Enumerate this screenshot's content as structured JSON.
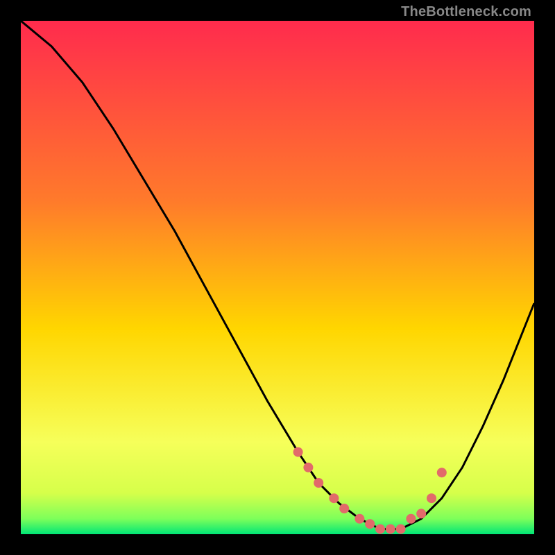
{
  "watermark": "TheBottleneck.com",
  "colors": {
    "bg": "#000000",
    "grad_top": "#ff2b4d",
    "grad_mid1": "#ff7a2b",
    "grad_mid2": "#ffd600",
    "grad_low": "#f6ff5a",
    "grad_bottom": "#00e676",
    "curve": "#000000",
    "dots": "#e26a6a"
  },
  "chart_data": {
    "type": "line",
    "title": "",
    "xlabel": "",
    "ylabel": "",
    "xlim": [
      0,
      100
    ],
    "ylim": [
      0,
      100
    ],
    "series": [
      {
        "name": "bottleneck-curve",
        "x": [
          0,
          6,
          12,
          18,
          24,
          30,
          36,
          42,
          48,
          54,
          58,
          62,
          66,
          70,
          74,
          78,
          82,
          86,
          90,
          94,
          98,
          100
        ],
        "y": [
          100,
          95,
          88,
          79,
          69,
          59,
          48,
          37,
          26,
          16,
          10,
          6,
          3,
          1,
          1,
          3,
          7,
          13,
          21,
          30,
          40,
          45
        ]
      }
    ],
    "dots": {
      "name": "markers",
      "x": [
        54,
        56,
        58,
        61,
        63,
        66,
        68,
        70,
        72,
        74,
        76,
        78,
        80,
        82
      ],
      "y": [
        16,
        13,
        10,
        7,
        5,
        3,
        2,
        1,
        1,
        1,
        3,
        4,
        7,
        12
      ]
    },
    "gradient_bands": [
      {
        "y": 98,
        "color": "#00e676"
      },
      {
        "y": 95,
        "color": "#7dff5a"
      },
      {
        "y": 90,
        "color": "#d6ff4a"
      },
      {
        "y": 82,
        "color": "#f6ff5a"
      },
      {
        "y": 60,
        "color": "#ffd600"
      },
      {
        "y": 35,
        "color": "#ff7a2b"
      },
      {
        "y": 0,
        "color": "#ff2b4d"
      }
    ]
  }
}
